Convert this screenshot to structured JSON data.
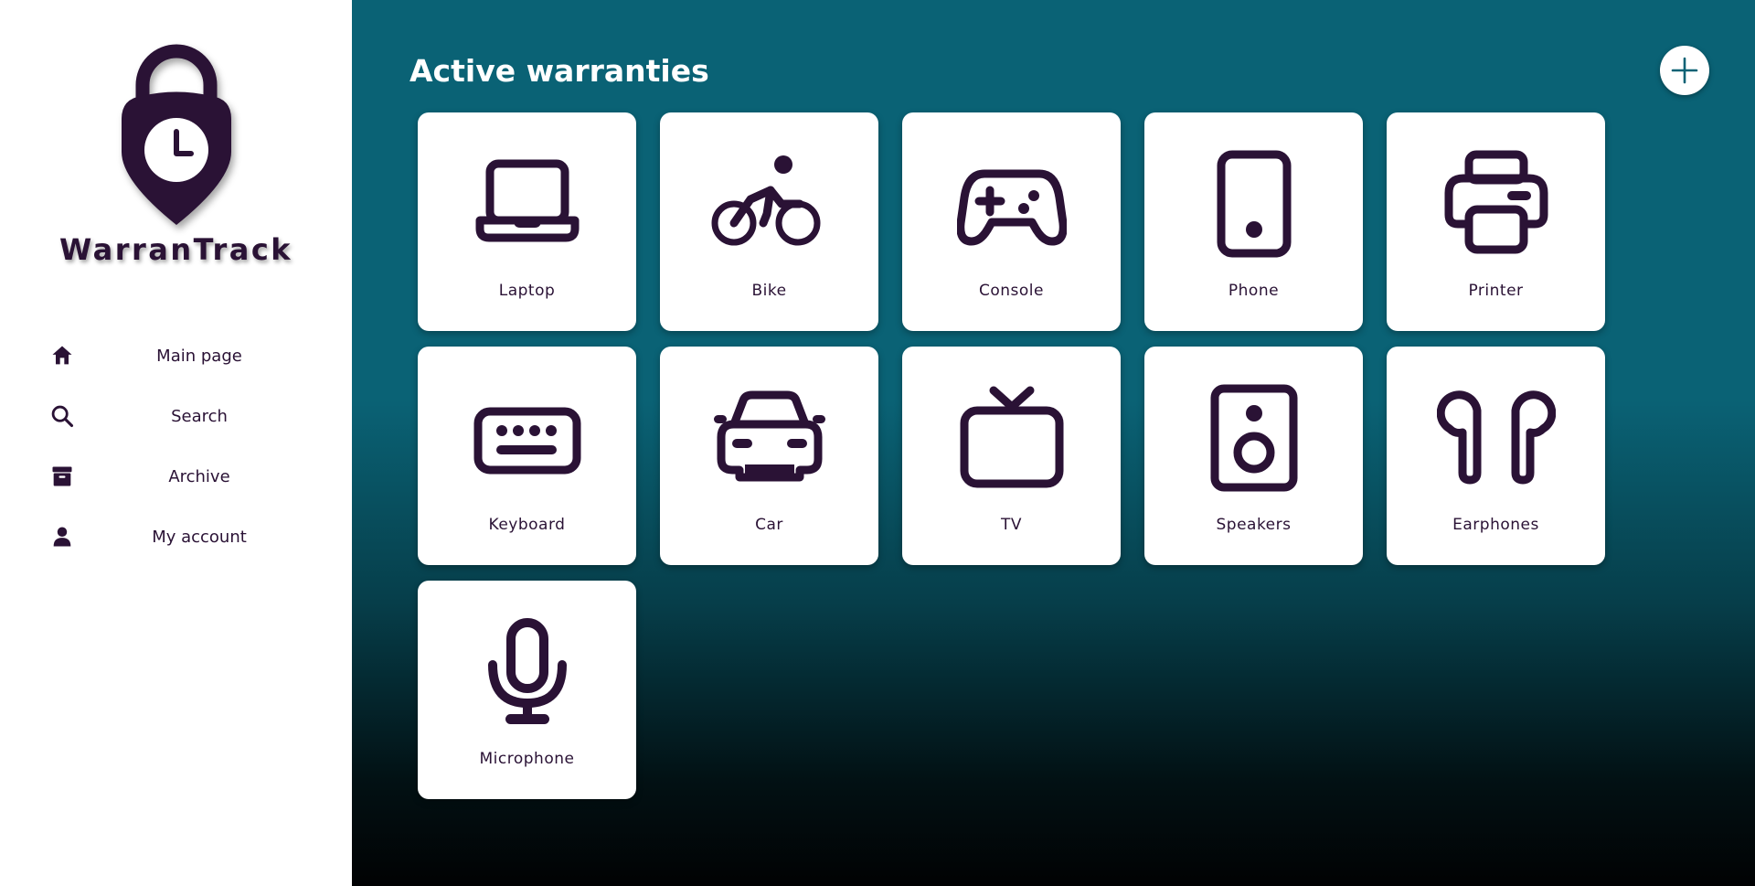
{
  "app": {
    "name": "WarranTrack"
  },
  "nav": {
    "items": [
      {
        "label": "Main page",
        "icon": "home-icon"
      },
      {
        "label": "Search",
        "icon": "search-icon"
      },
      {
        "label": "Archive",
        "icon": "archive-icon"
      },
      {
        "label": "My account",
        "icon": "user-icon"
      }
    ]
  },
  "main": {
    "title": "Active warranties",
    "add_button_icon": "plus-icon",
    "cards": [
      {
        "label": "Laptop",
        "icon": "laptop-icon"
      },
      {
        "label": "Bike",
        "icon": "bike-icon"
      },
      {
        "label": "Console",
        "icon": "gamepad-icon"
      },
      {
        "label": "Phone",
        "icon": "phone-icon"
      },
      {
        "label": "Printer",
        "icon": "printer-icon"
      },
      {
        "label": "Keyboard",
        "icon": "keyboard-icon"
      },
      {
        "label": "Car",
        "icon": "car-icon"
      },
      {
        "label": "TV",
        "icon": "tv-icon"
      },
      {
        "label": "Speakers",
        "icon": "speaker-icon"
      },
      {
        "label": "Earphones",
        "icon": "earphones-icon"
      },
      {
        "label": "Microphone",
        "icon": "microphone-icon"
      }
    ]
  },
  "colors": {
    "primary_dark": "#2a1235",
    "teal": "#0a6275",
    "white": "#ffffff"
  }
}
